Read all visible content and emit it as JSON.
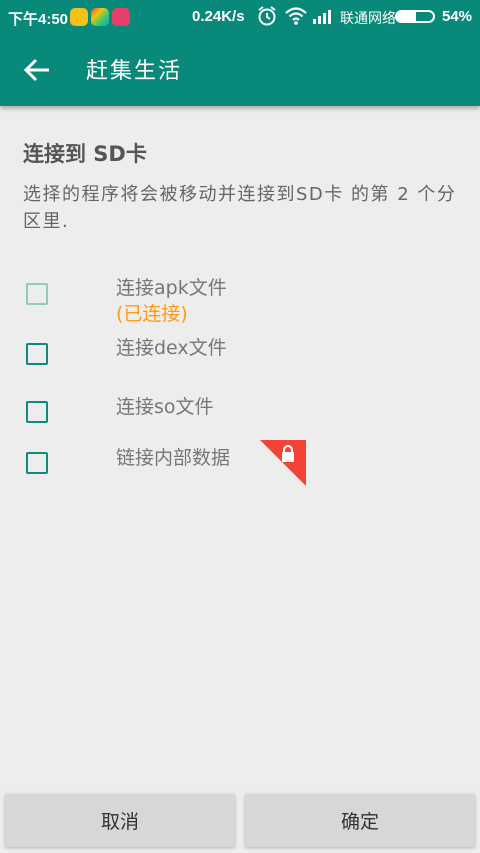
{
  "status_bar": {
    "time": "下午4:50",
    "network_speed": "0.24K/s",
    "carrier": "联通网络",
    "battery_percent": "54%",
    "battery_level": 0.54,
    "icons": [
      "app-icon-yellow",
      "app-icon-rainbow",
      "app-icon-red",
      "alarm-icon",
      "wifi-icon",
      "signal-icon",
      "battery-icon"
    ]
  },
  "app_bar": {
    "title": "赶集生活",
    "back_icon": "arrow-left-icon"
  },
  "section": {
    "heading": "连接到 SD卡",
    "description": "选择的程序将会被移动并连接到SD卡 的第 2 个分区里."
  },
  "options": [
    {
      "label": "连接apk文件",
      "sub_label": "(已连接)",
      "checked": false,
      "enabled": false
    },
    {
      "label": "连接dex文件",
      "checked": false,
      "enabled": true
    },
    {
      "label": "连接so文件",
      "checked": false,
      "enabled": true
    },
    {
      "label": "链接内部数据",
      "checked": false,
      "enabled": true,
      "locked": true,
      "lock_icon": "lock-icon"
    }
  ],
  "buttons": {
    "cancel": "取消",
    "ok": "确定"
  },
  "colors": {
    "accent": "#08897a",
    "checkbox": "#0f8a7e",
    "warning": "#ff9a10",
    "lock_badge": "#f44336",
    "background": "#ededed"
  }
}
